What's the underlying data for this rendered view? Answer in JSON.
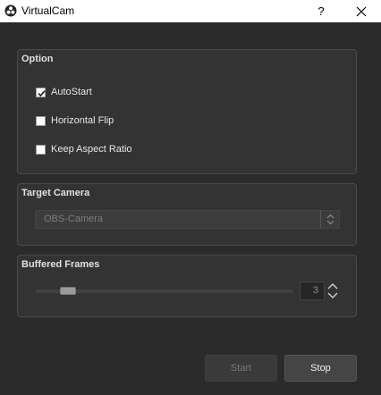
{
  "window": {
    "title": "VirtualCam",
    "help_label": "?",
    "app_icon": "obs-logo-icon",
    "close_icon": "close-icon"
  },
  "option_group": {
    "title": "Option",
    "checkboxes": [
      {
        "label": "AutoStart",
        "checked": true
      },
      {
        "label": "Horizontal Flip",
        "checked": false
      },
      {
        "label": "Keep Aspect Ratio",
        "checked": false
      }
    ]
  },
  "target_camera": {
    "title": "Target Camera",
    "selected": "OBS-Camera",
    "enabled": false
  },
  "buffered_frames": {
    "title": "Buffered Frames",
    "value": "3",
    "slider_fraction": 0.15
  },
  "actions": {
    "start_label": "Start",
    "start_enabled": false,
    "stop_label": "Stop",
    "stop_enabled": true
  },
  "colors": {
    "background": "#2b2b2b",
    "panel": "#333333",
    "titlebar": "#ffffff"
  }
}
